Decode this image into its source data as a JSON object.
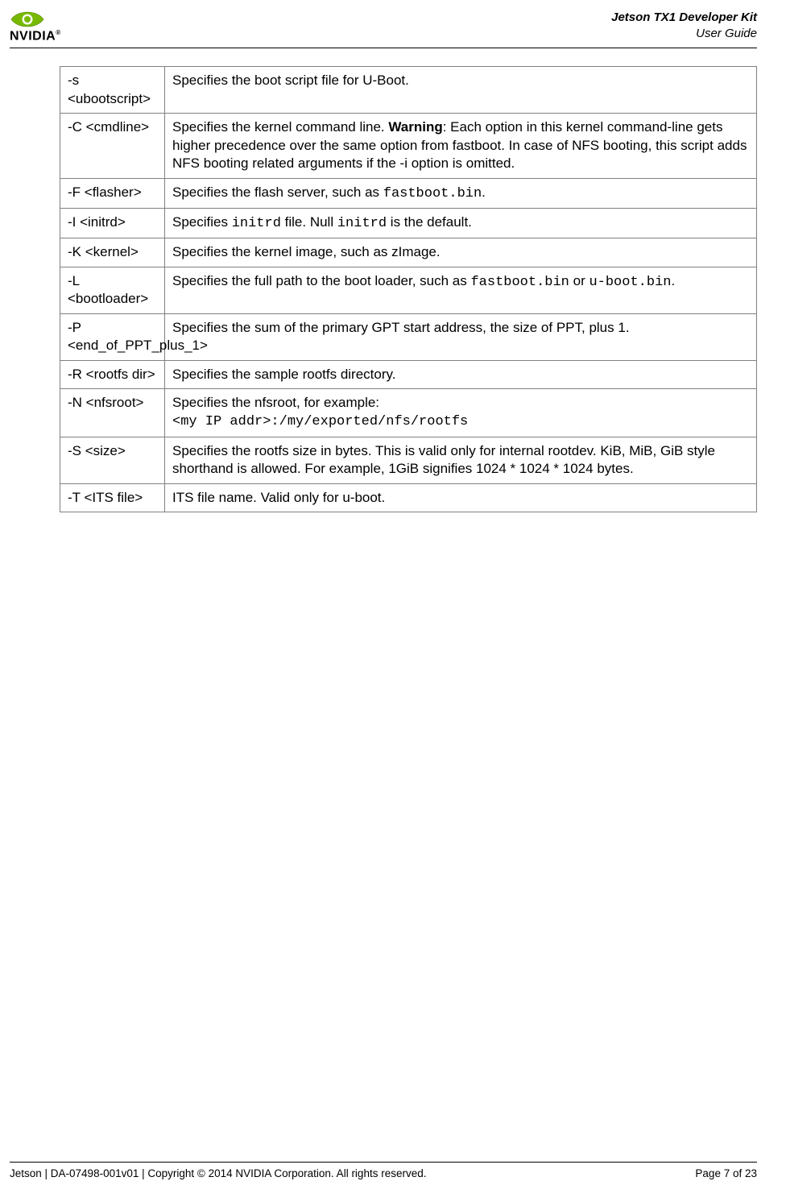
{
  "header": {
    "brand": "NVIDIA",
    "title_line1": "Jetson TX1 Developer Kit",
    "title_line2": "User Guide"
  },
  "rows": [
    {
      "opt": "-s <ubootscript>",
      "desc": [
        {
          "t": "Specifies the boot script file for U-Boot."
        }
      ]
    },
    {
      "opt": "-C <cmdline>",
      "desc": [
        {
          "t": "Specifies the kernel command line. "
        },
        {
          "t": "Warning",
          "b": true
        },
        {
          "t": ": Each option in this kernel command-line gets higher precedence over the same option from fastboot. In case of NFS booting, this script adds NFS booting related arguments if the -i option is omitted."
        }
      ]
    },
    {
      "opt": "-F <flasher>",
      "desc": [
        {
          "t": "Specifies the flash server, such as "
        },
        {
          "t": "fastboot.bin",
          "m": true
        },
        {
          "t": "."
        }
      ]
    },
    {
      "opt": "-I <initrd>",
      "desc": [
        {
          "t": "Specifies "
        },
        {
          "t": "initrd",
          "m": true
        },
        {
          "t": " file. Null "
        },
        {
          "t": "initrd",
          "m": true
        },
        {
          "t": " is the default."
        }
      ]
    },
    {
      "opt": "-K <kernel>",
      "desc": [
        {
          "t": "Specifies the kernel image, such as zImage."
        }
      ]
    },
    {
      "opt": "-L <bootloader>",
      "desc": [
        {
          "t": "Specifies the full path to the boot loader, such as "
        },
        {
          "t": "fastboot.bin",
          "m": true
        },
        {
          "t": " or "
        },
        {
          "t": "u-boot.bin",
          "m": true
        },
        {
          "t": "."
        }
      ]
    },
    {
      "opt": "-P <end_of_PPT_plus_1>",
      "desc": [
        {
          "t": "Specifies the sum of the primary GPT start address, the size of PPT, plus 1."
        }
      ]
    },
    {
      "opt": "-R <rootfs dir>",
      "desc": [
        {
          "t": "Specifies the sample rootfs directory."
        }
      ]
    },
    {
      "opt": "-N <nfsroot>",
      "desc": [
        {
          "t": "Specifies the nfsroot, for example:"
        },
        {
          "br": true
        },
        {
          "t": "<my IP addr>:/my/exported/nfs/rootfs",
          "m": true
        }
      ]
    },
    {
      "opt": "-S <size>",
      "desc": [
        {
          "t": "Specifies the rootfs size in bytes. This is valid only for internal rootdev. KiB, MiB, GiB style shorthand is allowed. For example, 1GiB signifies 1024 * 1024 * 1024 bytes."
        }
      ]
    },
    {
      "opt": "-T <ITS file>",
      "desc": [
        {
          "t": "ITS file name. Valid only for u-boot."
        }
      ]
    }
  ],
  "footer": {
    "left": "Jetson | DA-07498-001v01 | Copyright © 2014 NVIDIA Corporation. All rights reserved.",
    "right": "Page 7 of 23"
  }
}
